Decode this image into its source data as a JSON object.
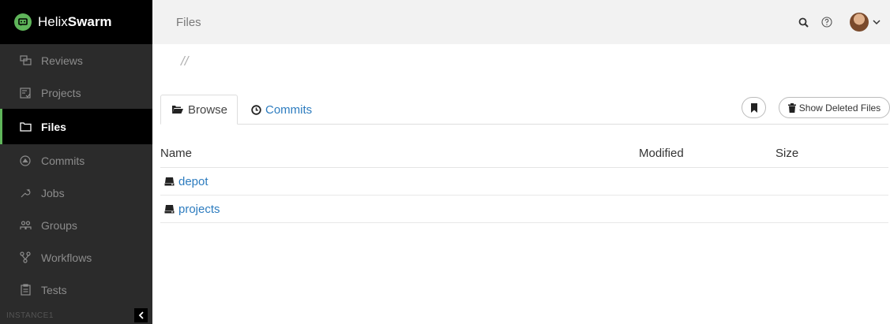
{
  "brand": {
    "name_light": "Helix",
    "name_bold": "Swarm"
  },
  "sidebar": {
    "items": [
      {
        "label": "Reviews",
        "icon": "reviews-icon"
      },
      {
        "label": "Projects",
        "icon": "projects-icon"
      },
      {
        "label": "Files",
        "icon": "folder-icon",
        "active": true
      },
      {
        "label": "Commits",
        "icon": "commits-icon"
      },
      {
        "label": "Jobs",
        "icon": "wrench-icon"
      },
      {
        "label": "Groups",
        "icon": "groups-icon"
      },
      {
        "label": "Workflows",
        "icon": "workflow-icon"
      },
      {
        "label": "Tests",
        "icon": "tests-icon"
      }
    ],
    "instance": "INSTANCE1"
  },
  "topbar": {
    "title": "Files"
  },
  "breadcrumb": "//",
  "tabs": {
    "browse": "Browse",
    "commits": "Commits"
  },
  "actions": {
    "show_deleted": "Show Deleted Files"
  },
  "table": {
    "headers": {
      "name": "Name",
      "modified": "Modified",
      "size": "Size"
    },
    "rows": [
      {
        "name": "depot"
      },
      {
        "name": "projects"
      }
    ]
  },
  "colors": {
    "accent": "#5fb55a",
    "link": "#2d7cbf",
    "sidebar_bg": "#2b2b2b"
  }
}
